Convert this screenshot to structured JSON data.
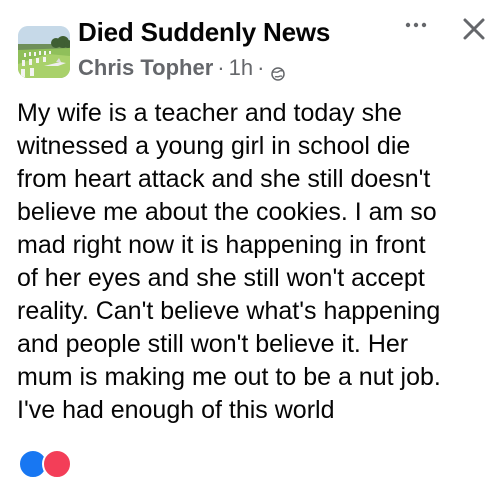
{
  "post": {
    "group_name": "Died Suddenly News",
    "author": "Chris Topher",
    "separator": "·",
    "time": "1h",
    "body": "My wife is a teacher and today she\nwitnessed a young girl in school die\nfrom heart attack and she still doesn't\nbelieve me about the cookies. I am so\nmad right now it is happening in front\nof her eyes and she still won't accept\nreality. Can't believe what's happening\nand people still won't believe it. Her\nmum is making me out to be a nut job.\nI've had enough of this world"
  },
  "icons": {
    "avatar": "cemetery-avatar",
    "privacy": "globe-icon",
    "more": "more-options-icon",
    "close": "close-icon",
    "reactions": [
      "like-icon",
      "love-icon"
    ]
  },
  "colors": {
    "text": "#050505",
    "secondary": "#65676b",
    "like": "#1877f2",
    "love": "#f33e58"
  }
}
